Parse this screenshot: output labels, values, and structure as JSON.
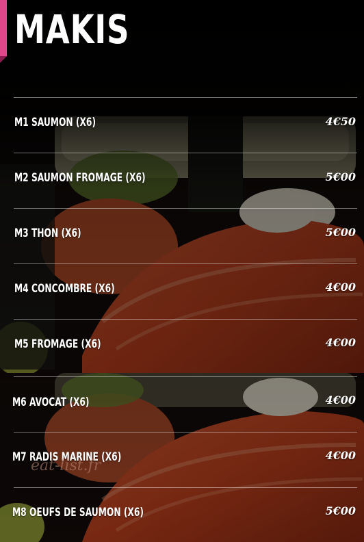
{
  "menu": {
    "title": "MAKIS",
    "items": [
      {
        "name": "M1 SAUMON (X6)",
        "price": "4€50"
      },
      {
        "name": "M2 SAUMON FROMAGE (X6)",
        "price": "5€00"
      },
      {
        "name": "M3 THON (X6)",
        "price": "5€00"
      },
      {
        "name": "M4 CONCOMBRE (X6)",
        "price": "4€00"
      },
      {
        "name": "M5 FROMAGE (X6)",
        "price": "4€00"
      },
      {
        "name": "M6 AVOCAT (X6)",
        "price": "4€00"
      },
      {
        "name": "M7 RADIS MARINE (X6)",
        "price": "4€00"
      },
      {
        "name": "M8 OEUFS DE SAUMON (X6)",
        "price": "5€00"
      }
    ]
  },
  "watermark": "eat-list.fr",
  "colors": {
    "accent": "#e0478a",
    "background": "#0a0706",
    "text": "#ffffff"
  }
}
